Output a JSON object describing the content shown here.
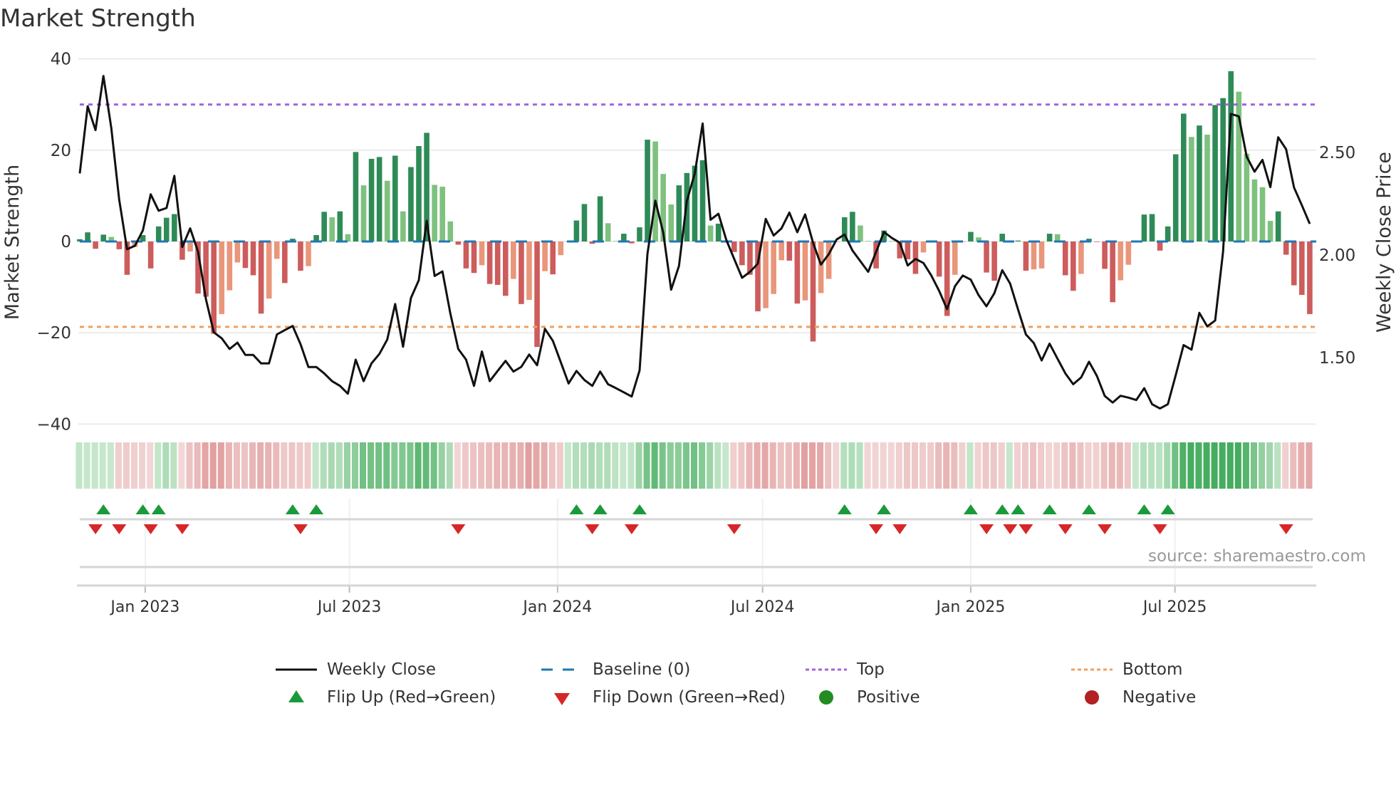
{
  "chart_data": {
    "type": "bar",
    "title": "Market Strength",
    "ylabel": "Market Strength",
    "ylabel_right": "Weekly Close Price",
    "ylim": [
      -40,
      40
    ],
    "yticks": [
      40,
      20,
      0,
      -20,
      -40
    ],
    "ytick_labels": [
      "40",
      "20",
      "0",
      "−20",
      "−40"
    ],
    "y2lim": [
      1.15,
      2.88
    ],
    "y2ticks": [
      2.5,
      2.0,
      1.5
    ],
    "y2tick_labels": [
      "2.50",
      "2.00",
      "1.50"
    ],
    "x_unit": "week index (weekly bars, first week approx. early Nov 2022)",
    "x_ticks": [
      {
        "label": "Jan 2023",
        "week": 8.3
      },
      {
        "label": "Jul 2023",
        "week": 34.2
      },
      {
        "label": "Jan 2024",
        "week": 60.6
      },
      {
        "label": "Jul 2024",
        "week": 86.6
      },
      {
        "label": "Jan 2025",
        "week": 113.0
      },
      {
        "label": "Jul 2025",
        "week": 138.9
      }
    ],
    "top_level": 30,
    "bottom_level": -18.7,
    "baseline": 0,
    "strength": [
      0.5,
      2,
      -1.6,
      1.5,
      1,
      -1.7,
      -7.3,
      -1.2,
      1.4,
      -5.9,
      3.3,
      5.2,
      6,
      -4,
      -2.2,
      -11.4,
      -12.1,
      -20.2,
      -15.9,
      -10.7,
      -4.6,
      -5.8,
      -7.4,
      -15.8,
      -12.5,
      -3.8,
      -9.1,
      0.6,
      -6.4,
      -5.4,
      1.4,
      6.5,
      5.3,
      6.6,
      1.6,
      19.6,
      12.3,
      18.1,
      18.5,
      13.3,
      18.8,
      6.6,
      16.3,
      20.9,
      23.8,
      12.4,
      12,
      4.4,
      -0.7,
      -5.9,
      -6.9,
      -5.2,
      -9.3,
      -9.5,
      -11.9,
      -8.2,
      -13.7,
      -12.8,
      -23.1,
      -6.5,
      -7.2,
      -3,
      -0.1,
      4.6,
      8.2,
      -0.5,
      9.9,
      4,
      0.1,
      1.7,
      -0.4,
      3.1,
      22.3,
      21.9,
      14.8,
      8.1,
      12.3,
      15,
      16.6,
      17.8,
      3.5,
      3.9,
      0.1,
      -2.3,
      -5.2,
      -7.3,
      -15.3,
      -14.6,
      -11.5,
      -4.1,
      -4.2,
      -13.6,
      -12.9,
      -21.9,
      -11.3,
      -8.2,
      -0.1,
      5.3,
      6.5,
      3.5,
      0.1,
      -5.9,
      2.4,
      0.1,
      -3.7,
      -3.9,
      -7.1,
      -2.4,
      -0.1,
      -7.7,
      -16.3,
      -7.3,
      -0.1,
      2.1,
      0.9,
      -6.8,
      -8.6,
      1.7,
      -0.2,
      0.2,
      -6.4,
      -6.1,
      -5.9,
      1.7,
      1.6,
      -7.4,
      -10.8,
      -7.1,
      0.6,
      -0.1,
      -6,
      -13.3,
      -8.5,
      -5.1,
      -0.1,
      5.9,
      6,
      -2,
      3.3,
      19.1,
      28,
      22.9,
      25.4,
      23.4,
      29.9,
      31.4,
      37.3,
      32.8,
      19.2,
      13.6,
      11.9,
      4.5,
      6.6,
      -2.9,
      -9.6,
      -11.7,
      -15.9
    ],
    "weekly_close": [
      2.398,
      2.725,
      2.609,
      2.873,
      2.618,
      2.271,
      2.028,
      2.045,
      2.12,
      2.296,
      2.216,
      2.229,
      2.386,
      2.039,
      2.13,
      2.016,
      1.785,
      1.623,
      1.594,
      1.542,
      1.573,
      1.513,
      1.513,
      1.472,
      1.472,
      1.613,
      1.634,
      1.654,
      1.565,
      1.454,
      1.454,
      1.423,
      1.385,
      1.362,
      1.324,
      1.49,
      1.385,
      1.472,
      1.518,
      1.588,
      1.761,
      1.553,
      1.79,
      1.877,
      2.167,
      1.898,
      1.92,
      1.715,
      1.542,
      1.49,
      1.362,
      1.53,
      1.385,
      1.435,
      1.484,
      1.432,
      1.455,
      1.515,
      1.463,
      1.64,
      1.582,
      1.478,
      1.374,
      1.435,
      1.391,
      1.362,
      1.432,
      1.37,
      1.351,
      1.331,
      1.31,
      1.438,
      2.005,
      2.265,
      2.109,
      1.831,
      1.947,
      2.265,
      2.398,
      2.641,
      2.172,
      2.201,
      2.074,
      1.981,
      1.889,
      1.918,
      1.958,
      2.176,
      2.095,
      2.13,
      2.207,
      2.111,
      2.198,
      2.06,
      1.953,
      2.005,
      2.076,
      2.1,
      2.022,
      1.97,
      1.918,
      2.016,
      2.112,
      2.083,
      2.06,
      1.949,
      1.981,
      1.961,
      1.9,
      1.825,
      1.736,
      1.848,
      1.9,
      1.88,
      1.804,
      1.75,
      1.814,
      1.926,
      1.86,
      1.735,
      1.613,
      1.571,
      1.486,
      1.568,
      1.495,
      1.423,
      1.37,
      1.403,
      1.48,
      1.411,
      1.313,
      1.281,
      1.314,
      1.305,
      1.293,
      1.351,
      1.273,
      1.252,
      1.273,
      1.414,
      1.561,
      1.539,
      1.718,
      1.652,
      1.681,
      2.016,
      2.688,
      2.676,
      2.479,
      2.406,
      2.464,
      2.331,
      2.574,
      2.516,
      2.329,
      2.242,
      2.152
    ],
    "flip_up_weeks": [
      3,
      8,
      10,
      27,
      30,
      63,
      66,
      71,
      97,
      102,
      113,
      117,
      119,
      123,
      128,
      135,
      138
    ],
    "flip_down_weeks": [
      2,
      5,
      9,
      13,
      28,
      48,
      65,
      70,
      83,
      101,
      104,
      115,
      118,
      120,
      125,
      130,
      137,
      153
    ],
    "legend": {
      "placement": "bottom",
      "items": [
        {
          "label": "Weekly Close",
          "kind": "line"
        },
        {
          "label": "Baseline (0)",
          "kind": "dash"
        },
        {
          "label": "Top",
          "kind": "dot-top"
        },
        {
          "label": "Bottom",
          "kind": "dot-bottom"
        },
        {
          "label": "Flip Up (Red→Green)",
          "kind": "tri-up"
        },
        {
          "label": "Flip Down (Green→Red)",
          "kind": "tri-down"
        },
        {
          "label": "Positive",
          "kind": "dot-pos"
        },
        {
          "label": "Negative",
          "kind": "dot-neg"
        }
      ]
    },
    "source": "source: sharemaestro.com",
    "colors": {
      "pos_strong": "#2e8b57",
      "pos_weak": "#7fc17f",
      "neg_strong": "#cd5c5c",
      "neg_weak": "#e9967a",
      "price": "#111111",
      "baseline": "#1f77b4",
      "top": "#a064dc",
      "bottom": "#f0a060",
      "flip_up": "#1a9a3a",
      "flip_down": "#d62728",
      "positive": "#228b22",
      "negative": "#b22222"
    }
  }
}
